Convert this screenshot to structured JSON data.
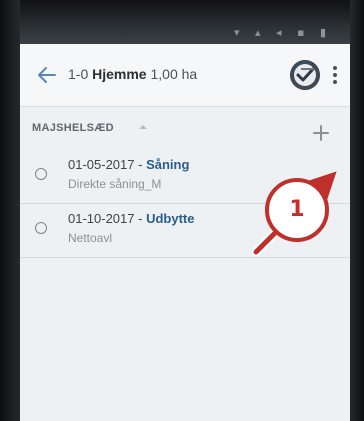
{
  "header": {
    "title_prefix": "1-0",
    "title_bold": "Hjemme",
    "title_suffix": "1,00 ha"
  },
  "section": {
    "title": "MAJSHELSÆD"
  },
  "items": [
    {
      "date": "01-05-2017",
      "separator": " - ",
      "activity": "Såning",
      "subtitle": "Direkte såning_M"
    },
    {
      "date": "01-10-2017",
      "separator": " - ",
      "activity": "Udbytte",
      "subtitle": "Nettoavl"
    }
  ],
  "annotation": {
    "number": "1",
    "color": "#c0302b"
  },
  "colors": {
    "accent": "#2b5e8a",
    "annotation_red": "#c0302b",
    "background": "#eef1f3"
  },
  "icons": [
    "back-arrow-icon",
    "sync-check-icon",
    "more-vertical-icon",
    "collapse-caret-icon",
    "add-icon"
  ]
}
